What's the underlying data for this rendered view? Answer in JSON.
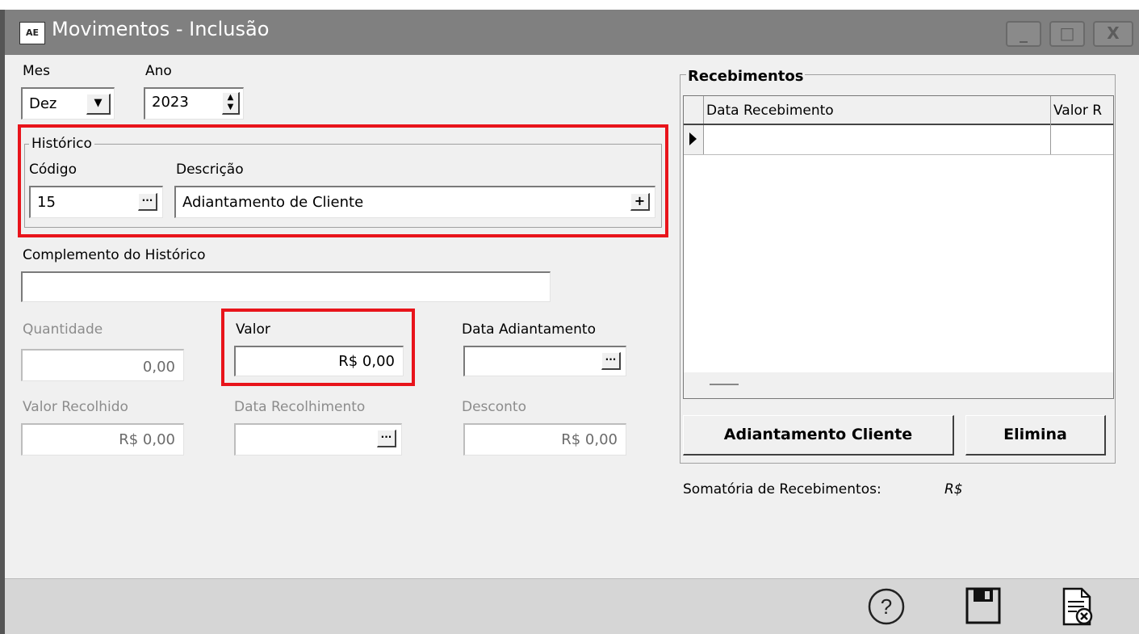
{
  "window": {
    "title": "Movimentos - Inclusão",
    "app_icon_text": "AE",
    "controls": {
      "minimize": "_",
      "maximize": "□",
      "close": "X"
    }
  },
  "period": {
    "mes_label": "Mes",
    "mes_value": "Dez",
    "ano_label": "Ano",
    "ano_value": "2023"
  },
  "historico": {
    "group_label": "Histórico",
    "codigo_label": "Código",
    "codigo_value": "15",
    "descricao_label": "Descrição",
    "descricao_value": "Adiantamento de Cliente"
  },
  "complemento": {
    "label": "Complemento do Histórico",
    "value": ""
  },
  "quantidade": {
    "label": "Quantidade",
    "value": "0,00"
  },
  "valor": {
    "label": "Valor",
    "value": "R$ 0,00"
  },
  "data_adiantamento": {
    "label": "Data Adiantamento",
    "value": ""
  },
  "valor_recolhido": {
    "label": "Valor Recolhido",
    "value": "R$ 0,00"
  },
  "data_recolhimento": {
    "label": "Data Recolhimento",
    "value": ""
  },
  "desconto": {
    "label": "Desconto",
    "value": "R$ 0,00"
  },
  "recebimentos": {
    "group_label": "Recebimentos",
    "columns": [
      "Data Recebimento",
      "Valor R"
    ],
    "rows": [],
    "adiantamento_button": "Adiantamento Cliente",
    "elimina_button": "Elimina",
    "somatoria_label": "Somatória de Recebimentos:",
    "somatoria_value": "R$"
  },
  "footer": {
    "help_icon": "help-icon",
    "save_icon": "save-icon",
    "cancel_icon": "cancel-document-icon"
  },
  "colors": {
    "highlight": "#e8141b",
    "titlebar": "#808080"
  }
}
